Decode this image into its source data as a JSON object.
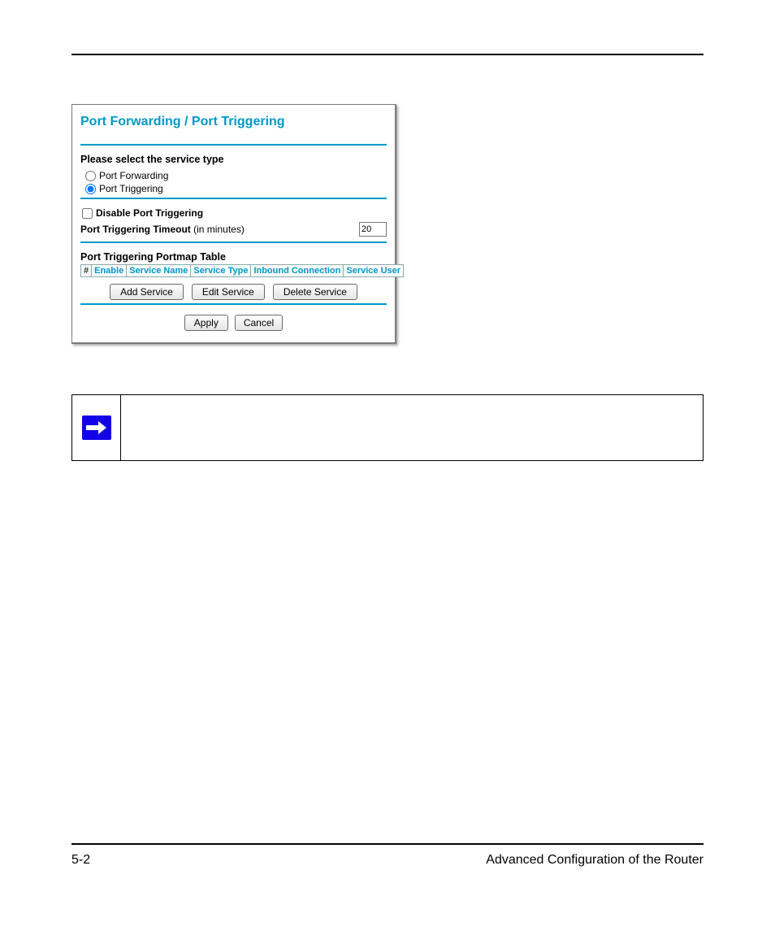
{
  "panel": {
    "title": "Port Forwarding / Port Triggering",
    "service_type_label": "Please select the service type",
    "radios": {
      "forwarding": "Port Forwarding",
      "triggering": "Port Triggering"
    },
    "disable_label": "Disable Port Triggering",
    "timeout": {
      "label": "Port Triggering Timeout",
      "suffix": "(in minutes)",
      "value": "20"
    },
    "portmap_label": "Port Triggering Portmap Table",
    "columns": {
      "num": "#",
      "enable": "Enable",
      "service_name": "Service Name",
      "service_type": "Service Type",
      "inbound": "Inbound Connection",
      "service_user": "Service User"
    },
    "buttons": {
      "add": "Add Service",
      "edit": "Edit Service",
      "del": "Delete Service",
      "apply": "Apply",
      "cancel": "Cancel"
    }
  },
  "footer": {
    "page": "5-2",
    "title": "Advanced Configuration of the Router"
  }
}
